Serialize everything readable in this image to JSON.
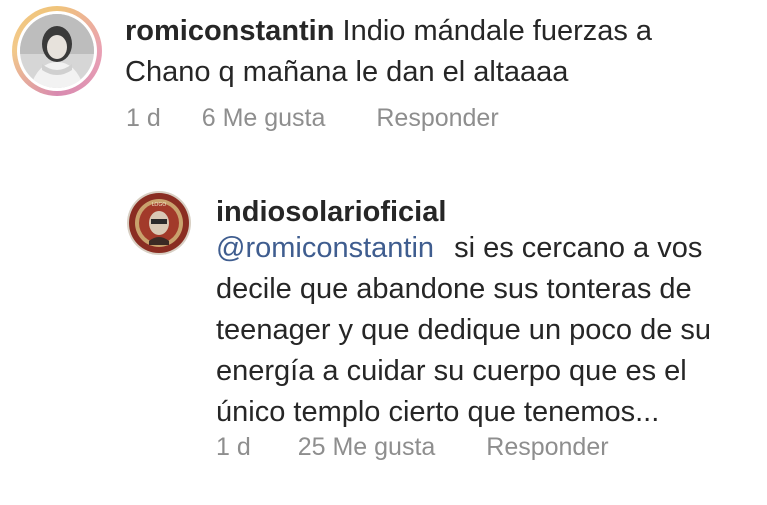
{
  "comment": {
    "avatar_icon": "profile-photo-avatar",
    "username": "romiconstantin",
    "text": "Indio mándale fuerzas a Chano q mañana le dan el altaaaa",
    "time": "1 d",
    "likes": "6 Me gusta",
    "reply_label": "Responder"
  },
  "reply": {
    "avatar_icon": "logo-avatar",
    "username": "indiosolarioficial",
    "mention": "@romiconstantin",
    "text": "si es cercano a vos decile que abandone sus tonteras de teenager y que dedique un poco de su energía a cuidar su cuerpo que es el único templo cierto que tenemos...",
    "time": "1 d",
    "likes": "25 Me gusta",
    "reply_label": "Responder"
  },
  "colors": {
    "text": "#262626",
    "meta": "#8e8e8e",
    "mention": "#3f5d8f",
    "story_ring": "#e9a0b4"
  }
}
